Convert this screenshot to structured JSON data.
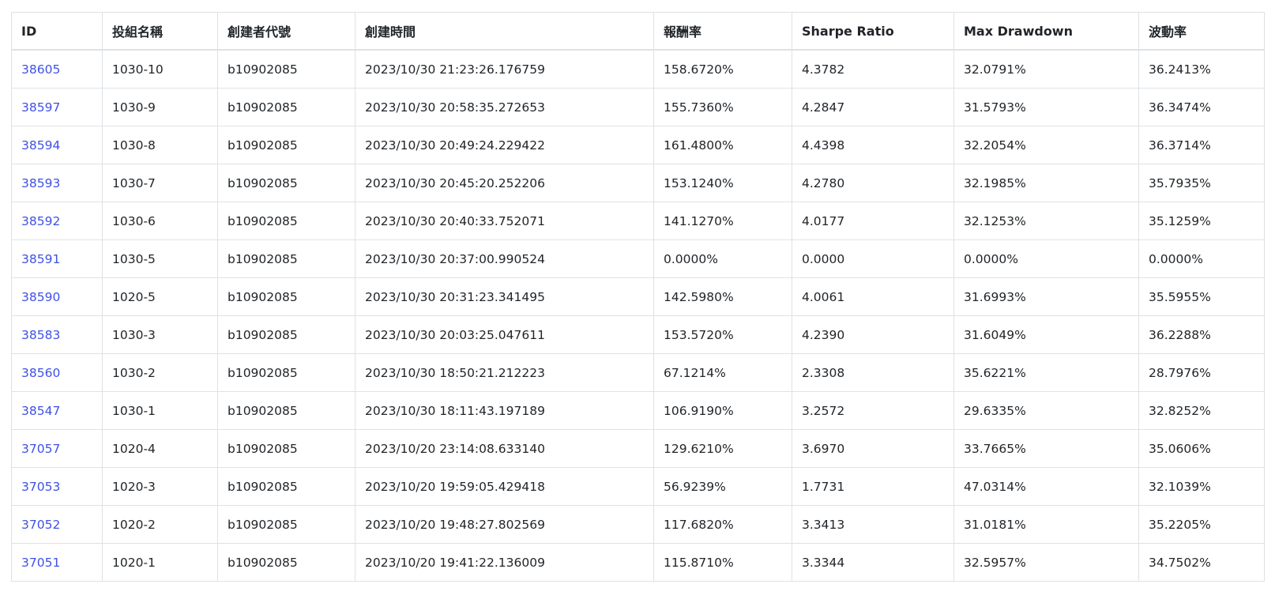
{
  "table": {
    "headers": {
      "id": "ID",
      "name": "投組名稱",
      "creator": "創建者代號",
      "created_at": "創建時間",
      "return_rate": "報酬率",
      "sharpe": "Sharpe Ratio",
      "max_drawdown": "Max Drawdown",
      "volatility": "波動率"
    },
    "rows": [
      {
        "id": "38605",
        "name": "1030-10",
        "creator": "b10902085",
        "created_at": "2023/10/30 21:23:26.176759",
        "return_rate": "158.6720%",
        "sharpe": "4.3782",
        "max_drawdown": "32.0791%",
        "volatility": "36.2413%"
      },
      {
        "id": "38597",
        "name": "1030-9",
        "creator": "b10902085",
        "created_at": "2023/10/30 20:58:35.272653",
        "return_rate": "155.7360%",
        "sharpe": "4.2847",
        "max_drawdown": "31.5793%",
        "volatility": "36.3474%"
      },
      {
        "id": "38594",
        "name": "1030-8",
        "creator": "b10902085",
        "created_at": "2023/10/30 20:49:24.229422",
        "return_rate": "161.4800%",
        "sharpe": "4.4398",
        "max_drawdown": "32.2054%",
        "volatility": "36.3714%"
      },
      {
        "id": "38593",
        "name": "1030-7",
        "creator": "b10902085",
        "created_at": "2023/10/30 20:45:20.252206",
        "return_rate": "153.1240%",
        "sharpe": "4.2780",
        "max_drawdown": "32.1985%",
        "volatility": "35.7935%"
      },
      {
        "id": "38592",
        "name": "1030-6",
        "creator": "b10902085",
        "created_at": "2023/10/30 20:40:33.752071",
        "return_rate": "141.1270%",
        "sharpe": "4.0177",
        "max_drawdown": "32.1253%",
        "volatility": "35.1259%"
      },
      {
        "id": "38591",
        "name": "1030-5",
        "creator": "b10902085",
        "created_at": "2023/10/30 20:37:00.990524",
        "return_rate": "0.0000%",
        "sharpe": "0.0000",
        "max_drawdown": "0.0000%",
        "volatility": "0.0000%"
      },
      {
        "id": "38590",
        "name": "1020-5",
        "creator": "b10902085",
        "created_at": "2023/10/30 20:31:23.341495",
        "return_rate": "142.5980%",
        "sharpe": "4.0061",
        "max_drawdown": "31.6993%",
        "volatility": "35.5955%"
      },
      {
        "id": "38583",
        "name": "1030-3",
        "creator": "b10902085",
        "created_at": "2023/10/30 20:03:25.047611",
        "return_rate": "153.5720%",
        "sharpe": "4.2390",
        "max_drawdown": "31.6049%",
        "volatility": "36.2288%"
      },
      {
        "id": "38560",
        "name": "1030-2",
        "creator": "b10902085",
        "created_at": "2023/10/30 18:50:21.212223",
        "return_rate": "67.1214%",
        "sharpe": "2.3308",
        "max_drawdown": "35.6221%",
        "volatility": "28.7976%"
      },
      {
        "id": "38547",
        "name": "1030-1",
        "creator": "b10902085",
        "created_at": "2023/10/30 18:11:43.197189",
        "return_rate": "106.9190%",
        "sharpe": "3.2572",
        "max_drawdown": "29.6335%",
        "volatility": "32.8252%"
      },
      {
        "id": "37057",
        "name": "1020-4",
        "creator": "b10902085",
        "created_at": "2023/10/20 23:14:08.633140",
        "return_rate": "129.6210%",
        "sharpe": "3.6970",
        "max_drawdown": "33.7665%",
        "volatility": "35.0606%"
      },
      {
        "id": "37053",
        "name": "1020-3",
        "creator": "b10902085",
        "created_at": "2023/10/20 19:59:05.429418",
        "return_rate": "56.9239%",
        "sharpe": "1.7731",
        "max_drawdown": "47.0314%",
        "volatility": "32.1039%"
      },
      {
        "id": "37052",
        "name": "1020-2",
        "creator": "b10902085",
        "created_at": "2023/10/20 19:48:27.802569",
        "return_rate": "117.6820%",
        "sharpe": "3.3413",
        "max_drawdown": "31.0181%",
        "volatility": "35.2205%"
      },
      {
        "id": "37051",
        "name": "1020-1",
        "creator": "b10902085",
        "created_at": "2023/10/20 19:41:22.136009",
        "return_rate": "115.8710%",
        "sharpe": "3.3344",
        "max_drawdown": "32.5957%",
        "volatility": "34.7502%"
      }
    ]
  }
}
